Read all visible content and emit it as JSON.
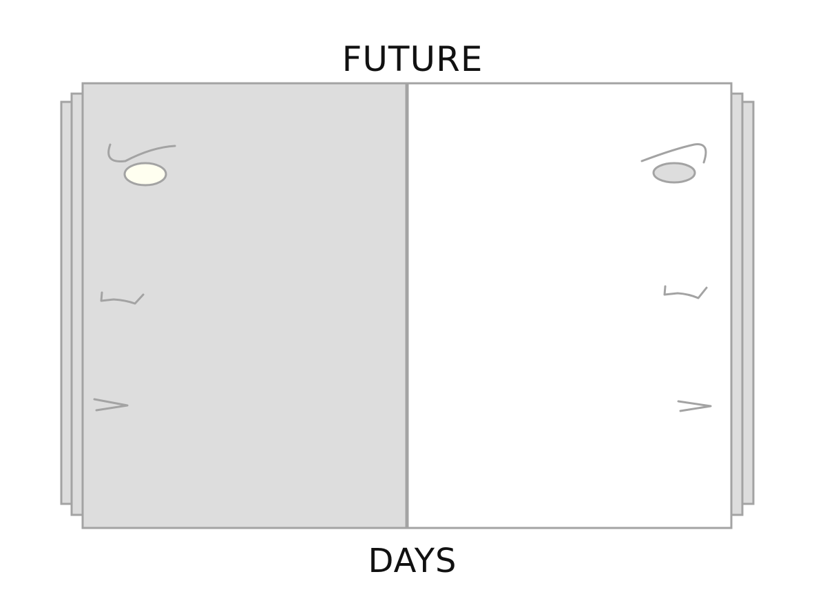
{
  "diagram": {
    "title": "FUTURE",
    "caption": "DAYS"
  },
  "colors": {
    "outline": "#a3a3a3",
    "left_page": "#dddddd",
    "right_page": "#ffffff",
    "lit_eye": "#fffff0",
    "dim_eye": "#dddddd",
    "text": "#111111"
  }
}
